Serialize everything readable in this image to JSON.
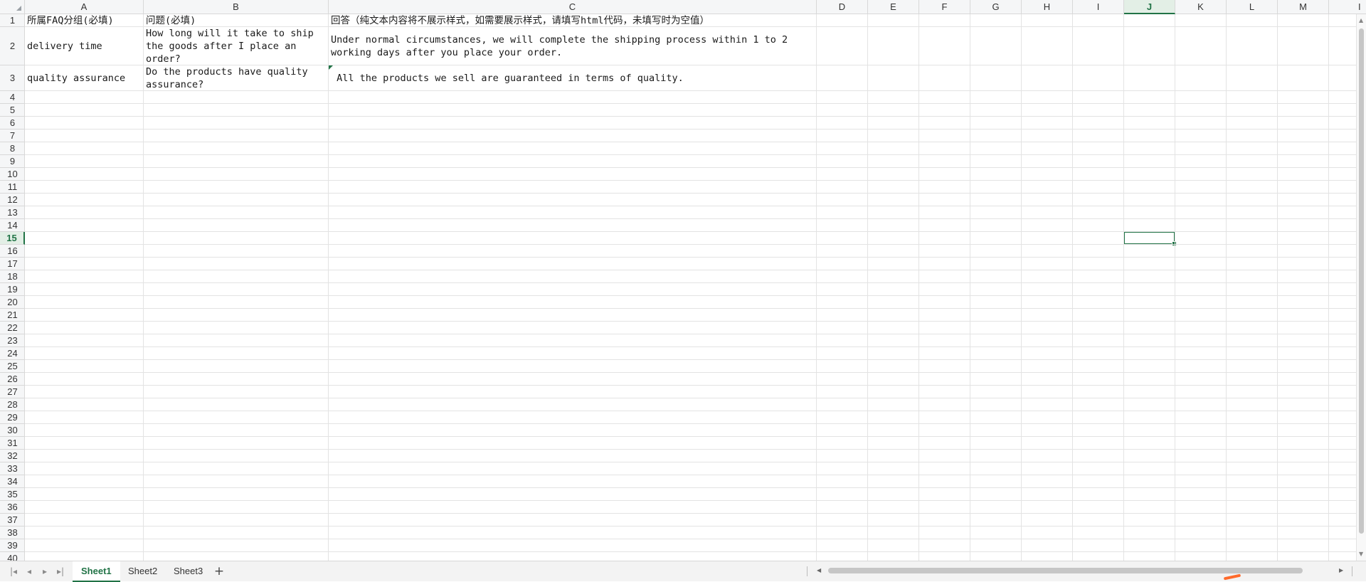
{
  "columns": [
    "A",
    "B",
    "C",
    "D",
    "E",
    "F",
    "G",
    "H",
    "I",
    "J",
    "K",
    "L",
    "M"
  ],
  "partial_column": "I",
  "active_column": "J",
  "rows": [
    "1",
    "2",
    "3",
    "4",
    "5",
    "6",
    "7",
    "8",
    "9",
    "10",
    "11",
    "12",
    "13",
    "14",
    "15",
    "16",
    "17",
    "18",
    "19",
    "20",
    "21",
    "22",
    "23",
    "24",
    "25",
    "26",
    "27",
    "28",
    "29",
    "30",
    "31",
    "32",
    "33",
    "34",
    "35",
    "36",
    "37",
    "38",
    "39",
    "40"
  ],
  "active_row": "15",
  "cells": {
    "A1": "所属FAQ分组(必填)",
    "B1": "问题(必填)",
    "C1": "回答（纯文本内容将不展示样式，如需要展示样式，请填写html代码，未填写时为空值）",
    "A2": "delivery time",
    "B2": "How long will it take to ship the goods after I place an order?",
    "C2": "Under normal circumstances, we will complete the shipping process within 1 to 2 working days after you place your order.",
    "A3": "quality assurance",
    "B3": "Do the products have quality assurance?",
    "C3": " All the products we sell are guaranteed in terms of quality."
  },
  "selected_cell": "J15",
  "sheet_tabs": [
    {
      "label": "Sheet1",
      "active": true
    },
    {
      "label": "Sheet2",
      "active": false
    },
    {
      "label": "Sheet3",
      "active": false
    }
  ],
  "add_sheet_label": "+",
  "nav_buttons": {
    "first": "|◂",
    "prev": "◂",
    "next": "▸",
    "last": "▸|"
  },
  "colors": {
    "accent": "#217346",
    "grid": "#e3e3e3",
    "header_bg": "#f5f6f7",
    "orange": "#ff6a2b"
  }
}
